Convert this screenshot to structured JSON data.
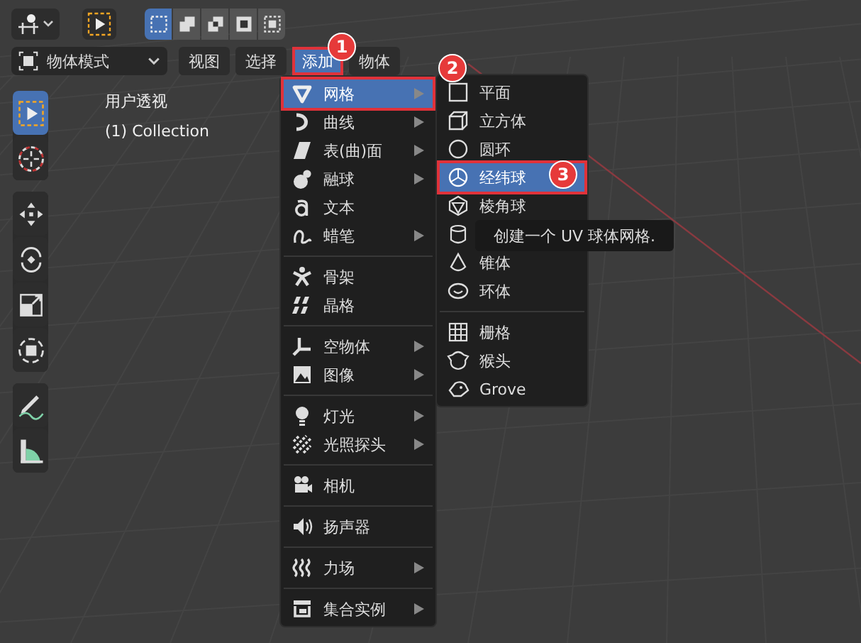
{
  "header": {
    "editor_button": {
      "expanded": false
    },
    "select_tool": {
      "selected": false
    },
    "select_modes": [
      {
        "selected": true
      },
      {
        "selected": false
      },
      {
        "selected": false
      },
      {
        "selected": false
      },
      {
        "selected": false
      }
    ],
    "mode_dropdown": {
      "value": "物体模式"
    },
    "menus": [
      {
        "label": "视图",
        "selected": false,
        "outlined": false
      },
      {
        "label": "选择",
        "selected": false,
        "outlined": false
      },
      {
        "label": "添加",
        "selected": true,
        "outlined": true
      },
      {
        "label": "物体",
        "selected": false,
        "outlined": false
      }
    ]
  },
  "viewport": {
    "view_name": "用户透视",
    "collection": "(1) Collection"
  },
  "toolbar": {
    "groups": [
      [
        {
          "selected": true
        },
        {
          "selected": false
        }
      ],
      [
        {
          "selected": false
        },
        {
          "selected": false
        },
        {
          "selected": false
        },
        {
          "selected": false
        }
      ],
      [
        {
          "selected": false
        },
        {
          "selected": false
        }
      ]
    ]
  },
  "add_menu": {
    "groups": [
      [
        {
          "label": "网格",
          "submenu": true,
          "selected": true,
          "outlined": true
        },
        {
          "label": "曲线",
          "submenu": true,
          "selected": false,
          "outlined": false
        },
        {
          "label": "表(曲)面",
          "submenu": true,
          "selected": false,
          "outlined": false
        },
        {
          "label": "融球",
          "submenu": true,
          "selected": false,
          "outlined": false
        },
        {
          "label": "文本",
          "submenu": false,
          "selected": false,
          "outlined": false
        },
        {
          "label": "蜡笔",
          "submenu": true,
          "selected": false,
          "outlined": false
        }
      ],
      [
        {
          "label": "骨架",
          "submenu": false,
          "selected": false,
          "outlined": false
        },
        {
          "label": "晶格",
          "submenu": false,
          "selected": false,
          "outlined": false
        }
      ],
      [
        {
          "label": "空物体",
          "submenu": true,
          "selected": false,
          "outlined": false
        },
        {
          "label": "图像",
          "submenu": true,
          "selected": false,
          "outlined": false
        }
      ],
      [
        {
          "label": "灯光",
          "submenu": true,
          "selected": false,
          "outlined": false
        },
        {
          "label": "光照探头",
          "submenu": true,
          "selected": false,
          "outlined": false
        }
      ],
      [
        {
          "label": "相机",
          "submenu": false,
          "selected": false,
          "outlined": false
        }
      ],
      [
        {
          "label": "扬声器",
          "submenu": false,
          "selected": false,
          "outlined": false
        }
      ],
      [
        {
          "label": "力场",
          "submenu": true,
          "selected": false,
          "outlined": false
        }
      ],
      [
        {
          "label": "集合实例",
          "submenu": true,
          "selected": false,
          "outlined": false
        }
      ]
    ]
  },
  "mesh_menu": {
    "groups": [
      [
        {
          "label": "平面",
          "selected": false,
          "outlined": false
        },
        {
          "label": "立方体",
          "selected": false,
          "outlined": false
        },
        {
          "label": "圆环",
          "selected": false,
          "outlined": false
        },
        {
          "label": "经纬球",
          "selected": true,
          "outlined": true
        },
        {
          "label": "棱角球",
          "selected": false,
          "outlined": false
        },
        {
          "selected": false,
          "outlined": false
        },
        {
          "label": "锥体",
          "selected": false,
          "outlined": false
        },
        {
          "label": "环体",
          "selected": false,
          "outlined": false
        }
      ],
      [
        {
          "label": "栅格",
          "selected": false,
          "outlined": false
        },
        {
          "label": "猴头",
          "selected": false,
          "outlined": false
        },
        {
          "label": "Grove",
          "selected": false,
          "outlined": false
        }
      ]
    ]
  },
  "tooltip": {
    "text": "创建一个 UV 球体网格."
  },
  "callouts": [
    "1",
    "2",
    "3"
  ]
}
